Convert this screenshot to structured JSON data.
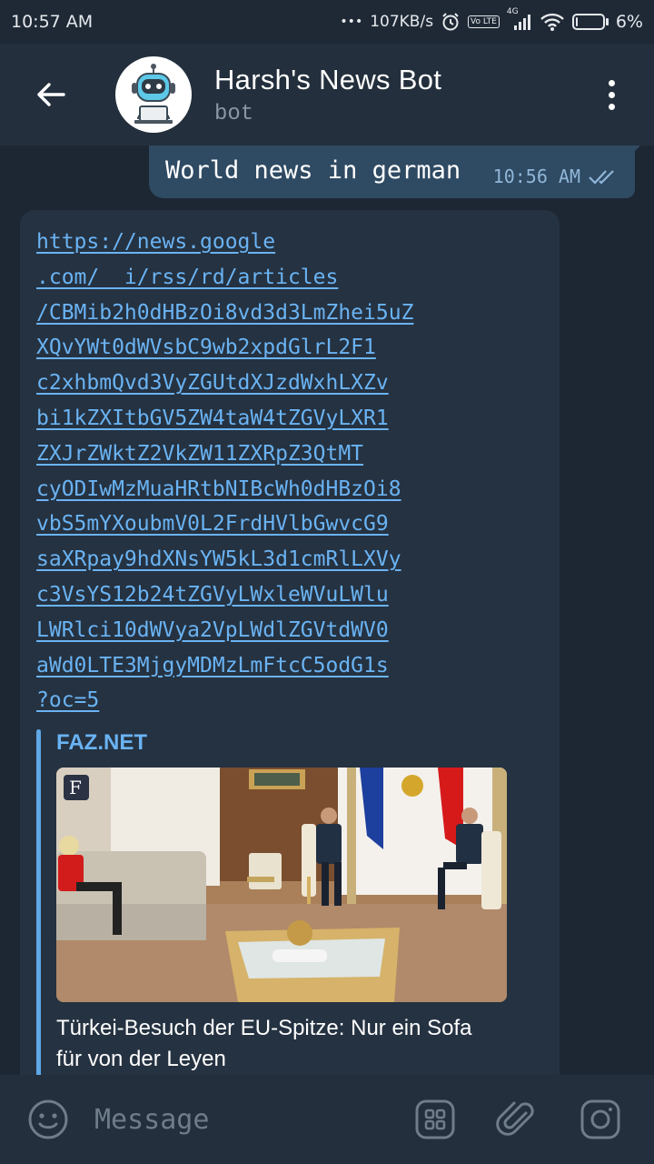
{
  "status_bar": {
    "time": "10:57 AM",
    "dots": "•••",
    "network_speed": "107KB/s",
    "volte": "Vo LTE",
    "network_type": "4G",
    "battery": "6%",
    "battery_level": 0.06
  },
  "header": {
    "title": "Harsh's News Bot",
    "subtitle": "bot"
  },
  "messages": {
    "outgoing": {
      "text": "World news in german",
      "time": "10:56 AM"
    },
    "incoming": {
      "link_lines": [
        "https://news.google",
        ".com/__i/rss/rd/articles",
        "/CBMib2h0dHBzOi8vd3d3LmZhei5uZ",
        "XQvYWt0dWVsbC9wb2xpdGlrL2F1",
        "c2xhbmQvd3VyZGUtdXJzdWxhLXZv",
        "bi1kZXItbGV5ZW4taW4tZGVyLXR1",
        "ZXJrZWktZ2VkZW11ZXRpZ3QtMT",
        "cyODIwMzMuaHRtbNIBcWh0dHBzOi8",
        "vbS5mYXoubmV0L2FrdHVlbGwvcG9",
        "saXRpay9hdXNsYW5kL3d1cmRlLXVy",
        "c3VsYS12b24tZGVyLWxleWVuLWlu",
        "LWRlci10dWVya2VpLWdlZGVtdWV0",
        "aWd0LTE3MjgyMDMzLmFtcC5odG1s",
        "?oc=5"
      ],
      "preview": {
        "site": "FAZ.NET",
        "title": "Türkei-Besuch der EU-Spitze: Nur ein Sofa für von der Leyen",
        "description": ""
      }
    }
  },
  "input_bar": {
    "placeholder": "Message"
  },
  "colors": {
    "accent": "#6ab3f3",
    "header_bg": "#232f3c",
    "chat_bg": "#1d2733",
    "outgoing_bubble": "#2f4a63",
    "incoming_bubble": "#253241"
  },
  "icons": {
    "back": "arrow-left-icon",
    "menu": "more-vertical-icon",
    "emoji": "smiley-icon",
    "sticker": "sticker-grid-icon",
    "attach": "paperclip-icon",
    "camera": "camera-icon",
    "read": "double-check-icon"
  }
}
